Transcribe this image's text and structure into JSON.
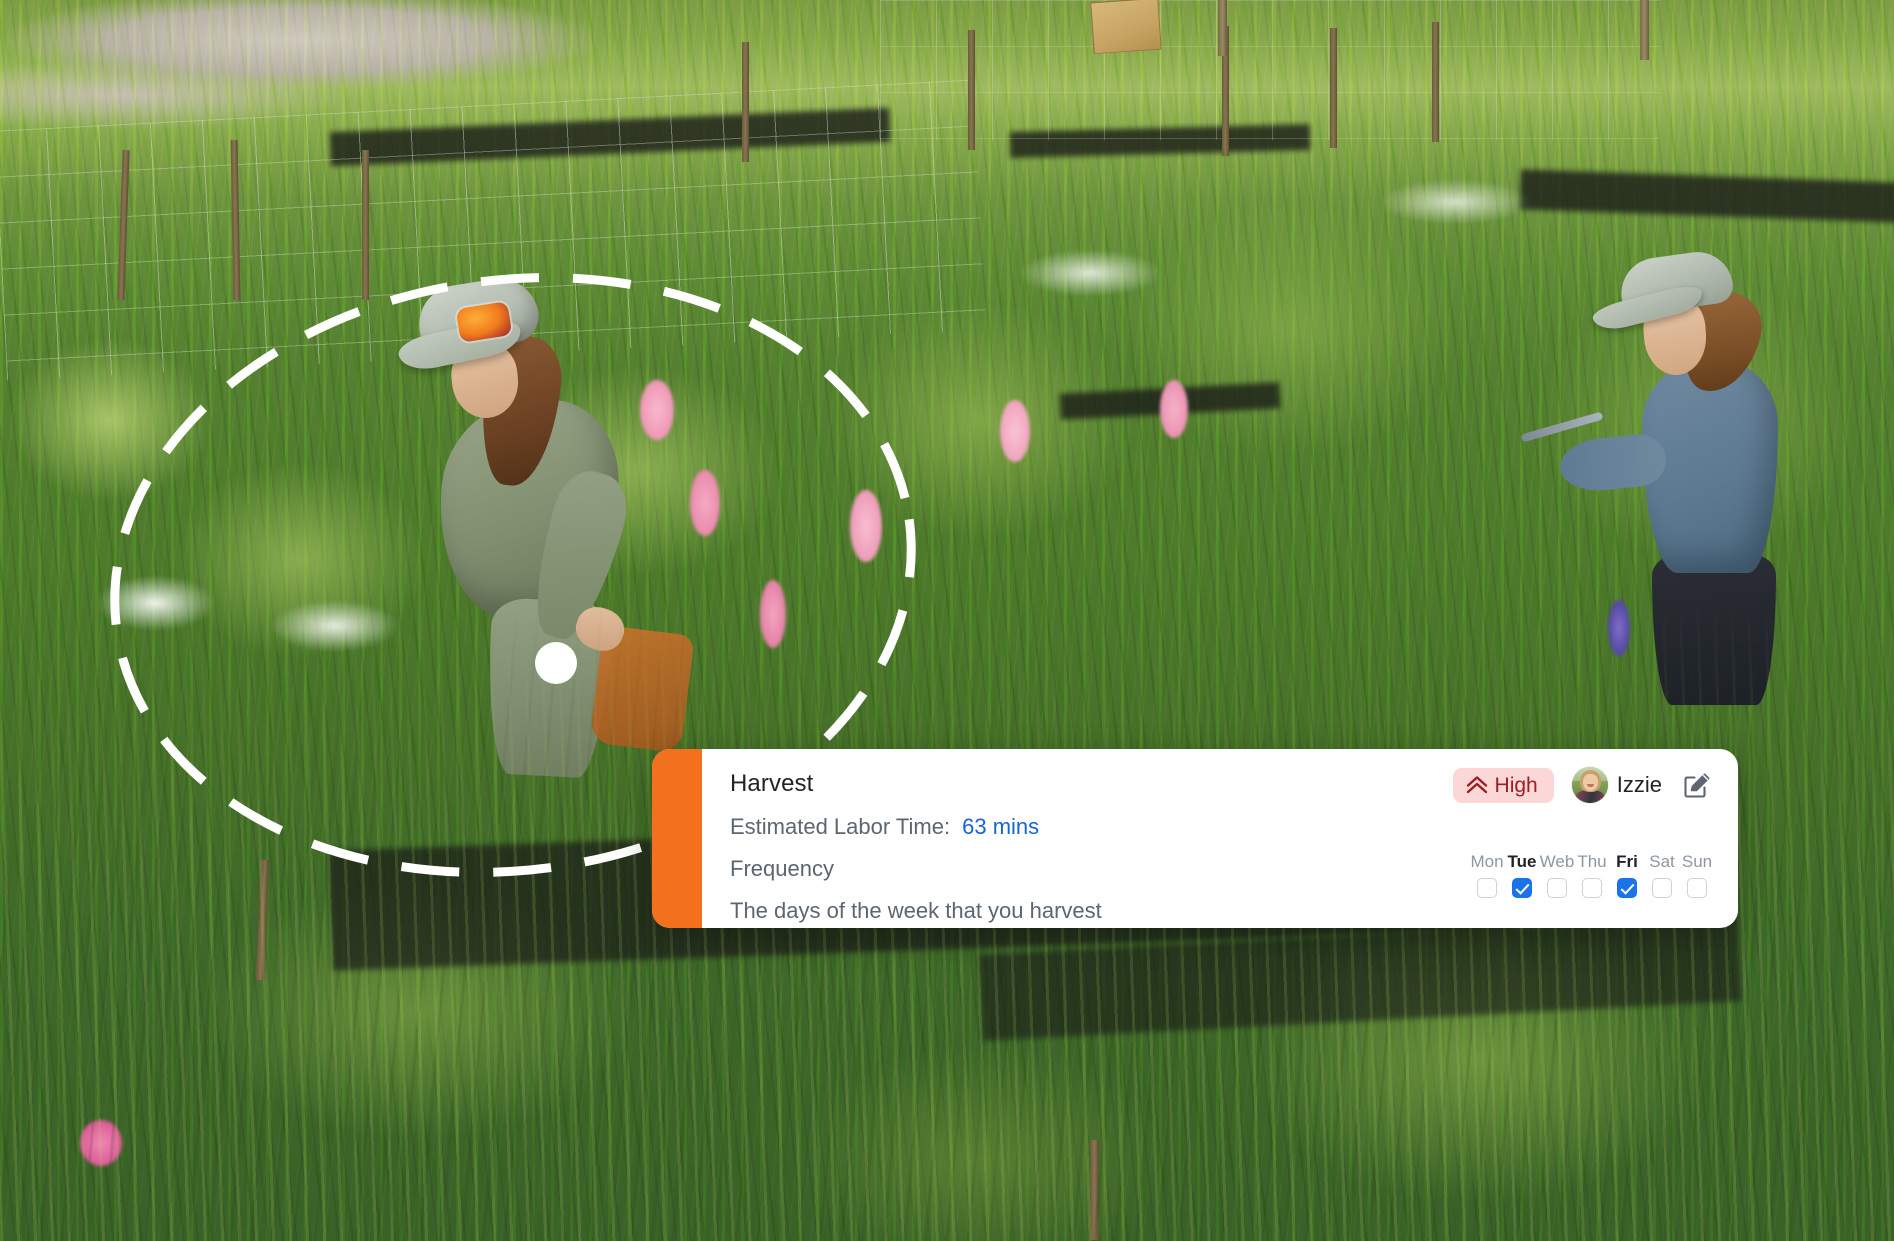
{
  "background": {
    "scene_description": "Aerial photo of a flower farm; two workers harvesting in rows of green stems with pink and white blossoms",
    "annotation": {
      "shape": "dashed-circle",
      "color": "#ffffff",
      "handle": "drag-handle-dot"
    }
  },
  "card": {
    "accent_color": "#f3701e",
    "title": "Harvest",
    "labor": {
      "label": "Estimated Labor Time:",
      "value": "63 mins",
      "value_color": "#1565d8"
    },
    "frequency": {
      "label": "Frequency",
      "description": "The days of the week that you harvest"
    },
    "priority": {
      "label": "High",
      "icon": "double-chevron-up-icon",
      "background_color": "#fbd7d7",
      "text_color": "#9c1f23"
    },
    "assignee": {
      "name": "Izzie",
      "avatar": "user-avatar"
    },
    "edit": {
      "icon": "edit-pencil-icon",
      "label": "Edit"
    },
    "days": [
      {
        "label": "Mon",
        "checked": false
      },
      {
        "label": "Tue",
        "checked": true
      },
      {
        "label": "Web",
        "checked": false
      },
      {
        "label": "Thu",
        "checked": false
      },
      {
        "label": "Fri",
        "checked": true
      },
      {
        "label": "Sat",
        "checked": false
      },
      {
        "label": "Sun",
        "checked": false
      }
    ]
  }
}
